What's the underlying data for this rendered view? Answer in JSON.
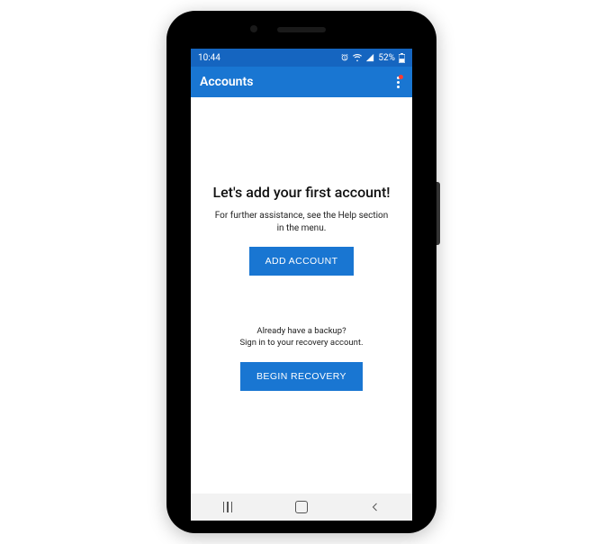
{
  "statusbar": {
    "time": "10:44",
    "battery_text": "52%"
  },
  "appbar": {
    "title": "Accounts"
  },
  "main": {
    "headline": "Let's add your first account!",
    "help_line1": "For further assistance, see the Help section",
    "help_line2": "in the menu.",
    "add_button": "ADD ACCOUNT",
    "backup_line1": "Already have a backup?",
    "backup_line2": "Sign in to your recovery account.",
    "recovery_button": "BEGIN RECOVERY"
  }
}
